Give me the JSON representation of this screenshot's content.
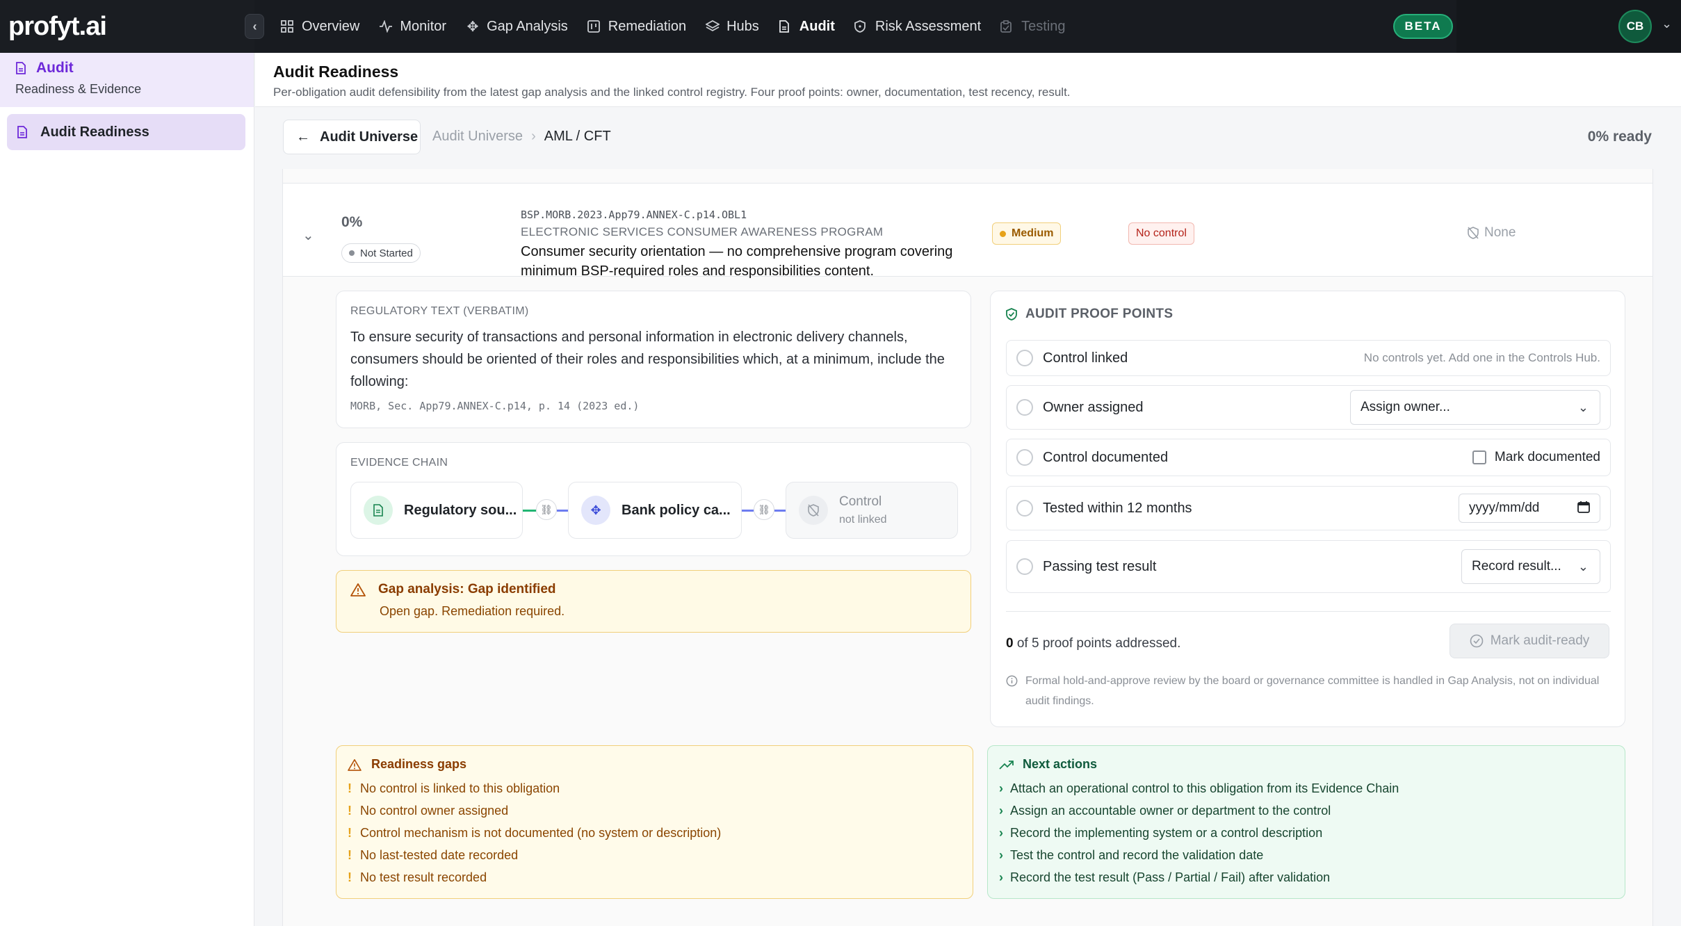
{
  "app": {
    "logo": "profyt.ai",
    "beta": "BETA",
    "avatar": "CB"
  },
  "nav": [
    {
      "label": "Overview",
      "icon": "grid-icon",
      "state": "normal"
    },
    {
      "label": "Monitor",
      "icon": "activity-icon",
      "state": "normal"
    },
    {
      "label": "Gap Analysis",
      "icon": "sparkle-icon",
      "state": "normal"
    },
    {
      "label": "Remediation",
      "icon": "board-icon",
      "state": "normal"
    },
    {
      "label": "Hubs",
      "icon": "layers-icon",
      "state": "normal"
    },
    {
      "label": "Audit",
      "icon": "file-icon",
      "state": "active"
    },
    {
      "label": "Risk Assessment",
      "icon": "shield-icon",
      "state": "normal"
    },
    {
      "label": "Testing",
      "icon": "clipboard-icon",
      "state": "disabled"
    }
  ],
  "sidebar": {
    "section_title": "Audit",
    "section_subtitle": "Readiness & Evidence",
    "items": [
      {
        "label": "Audit Readiness"
      }
    ]
  },
  "page": {
    "title": "Audit Readiness",
    "description": "Per-obligation audit defensibility from the latest gap analysis and the linked control registry. Four proof points: owner, documentation, test recency, result."
  },
  "breadcrumb": {
    "back_label": "Audit Universe",
    "root": "Audit Universe",
    "separator": "›",
    "current": "AML / CFT",
    "ready": "0% ready"
  },
  "obligation": {
    "percent": "0%",
    "status": "Not Started",
    "ref": "BSP.MORB.2023.App79.ANNEX-C.p14.OBL1",
    "program": "ELECTRONIC SERVICES CONSUMER AWARENESS PROGRAM",
    "text": "Consumer security orientation — no comprehensive program covering minimum BSP-required roles and responsibilities content.",
    "severity": "Medium",
    "control_status": "No control",
    "owner": "None"
  },
  "regulatory": {
    "heading": "REGULATORY TEXT (VERBATIM)",
    "text": "To ensure security of transactions and personal information in electronic delivery channels, consumers should be oriented of their roles and responsibilities which, at a minimum, include the following:",
    "citation": "MORB, Sec. App79.ANNEX-C.p14, p. 14 (2023 ed.)"
  },
  "evidence_chain": {
    "heading": "EVIDENCE CHAIN",
    "nodes": [
      {
        "label": "Regulatory sou..."
      },
      {
        "label": "Bank policy ca..."
      },
      {
        "label": "Control",
        "sub": "not linked"
      }
    ],
    "colors": {
      "link1": "#22b573",
      "link2": "#6d7cf0"
    }
  },
  "gap": {
    "title": "Gap analysis: Gap identified",
    "description": "Open gap. Remediation required."
  },
  "proof_points": {
    "title": "AUDIT PROOF POINTS",
    "rows": [
      {
        "label": "Control linked",
        "hint": "No controls yet. Add one in the Controls Hub."
      },
      {
        "label": "Owner assigned",
        "select": "Assign owner..."
      },
      {
        "label": "Control documented",
        "checkbox": "Mark documented"
      },
      {
        "label": "Tested within 12 months",
        "date_placeholder": "yyyy/mm/dd"
      },
      {
        "label": "Passing test result",
        "select": "Record result..."
      }
    ],
    "addressed_count": "0",
    "addressed_text": "of 5 proof points addressed.",
    "mark_ready": "Mark audit-ready",
    "note": "Formal hold-and-approve review by the board or governance committee is handled in Gap Analysis, not on individual audit findings."
  },
  "readiness_gaps": {
    "title": "Readiness gaps",
    "items": [
      "No control is linked to this obligation",
      "No control owner assigned",
      "Control mechanism is not documented (no system or description)",
      "No last-tested date recorded",
      "No test result recorded"
    ]
  },
  "next_actions": {
    "title": "Next actions",
    "items": [
      "Attach an operational control to this obligation from its Evidence Chain",
      "Assign an accountable owner or department to the control",
      "Record the implementing system or a control description",
      "Test the control and record the validation date",
      "Record the test result (Pass / Partial / Fail) after validation"
    ]
  }
}
